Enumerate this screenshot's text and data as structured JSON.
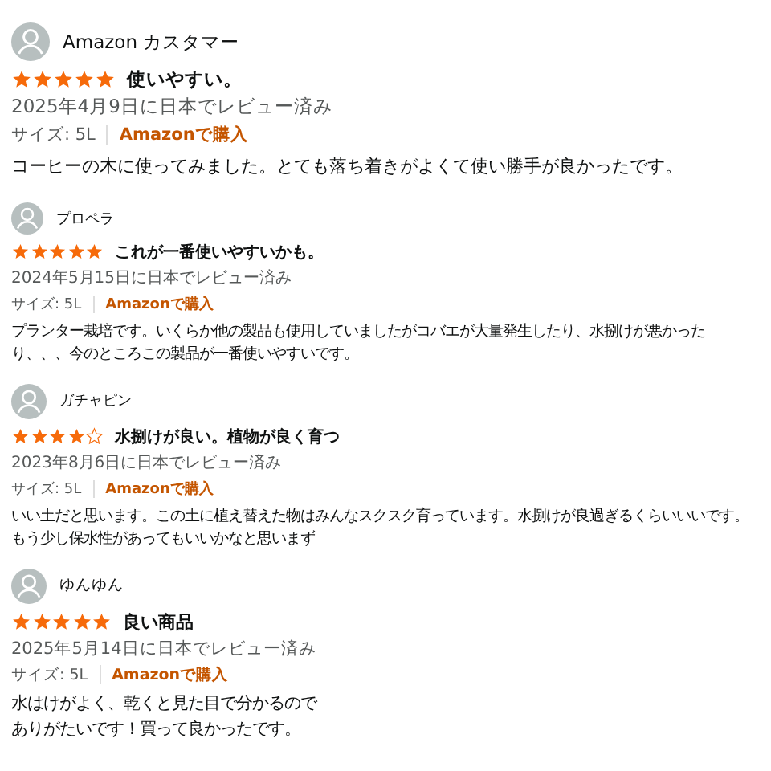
{
  "reviews": [
    {
      "reviewer": "Amazon カスタマー",
      "stars": 5,
      "title": "使いやすい。",
      "date": "2025年4月9日に日本でレビュー済み",
      "size": "サイズ: 5L",
      "badge": "Amazonで購入",
      "body": "コーヒーの木に使ってみました。とても落ち着きがよくて使い勝手が良かったです。"
    },
    {
      "reviewer": "プロペラ",
      "stars": 5,
      "title": "これが一番使いやすいかも。",
      "date": "2024年5月15日に日本でレビュー済み",
      "size": "サイズ: 5L",
      "badge": "Amazonで購入",
      "body": "プランター栽培です。いくらか他の製品も使用していましたがコバエが大量発生したり、水捌けが悪かったり、、、今のところこの製品が一番使いやすいです。"
    },
    {
      "reviewer": "ガチャピン",
      "stars": 4,
      "title": "水捌けが良い。植物が良く育つ",
      "date": "2023年8月6日に日本でレビュー済み",
      "size": "サイズ: 5L",
      "badge": "Amazonで購入",
      "body": "いい土だと思います。この土に植え替えた物はみんなスクスク育っています。水捌けが良過ぎるくらいいいです。もう少し保水性があってもいいかなと思いまず"
    },
    {
      "reviewer": "ゆんゆん",
      "stars": 5,
      "title": "良い商品",
      "date": "2025年5月14日に日本でレビュー済み",
      "size": "サイズ: 5L",
      "badge": "Amazonで購入",
      "body": "水はけがよく、乾くと見た目で分かるので",
      "body_2": "ありがたいです！買って良かったです。"
    }
  ]
}
